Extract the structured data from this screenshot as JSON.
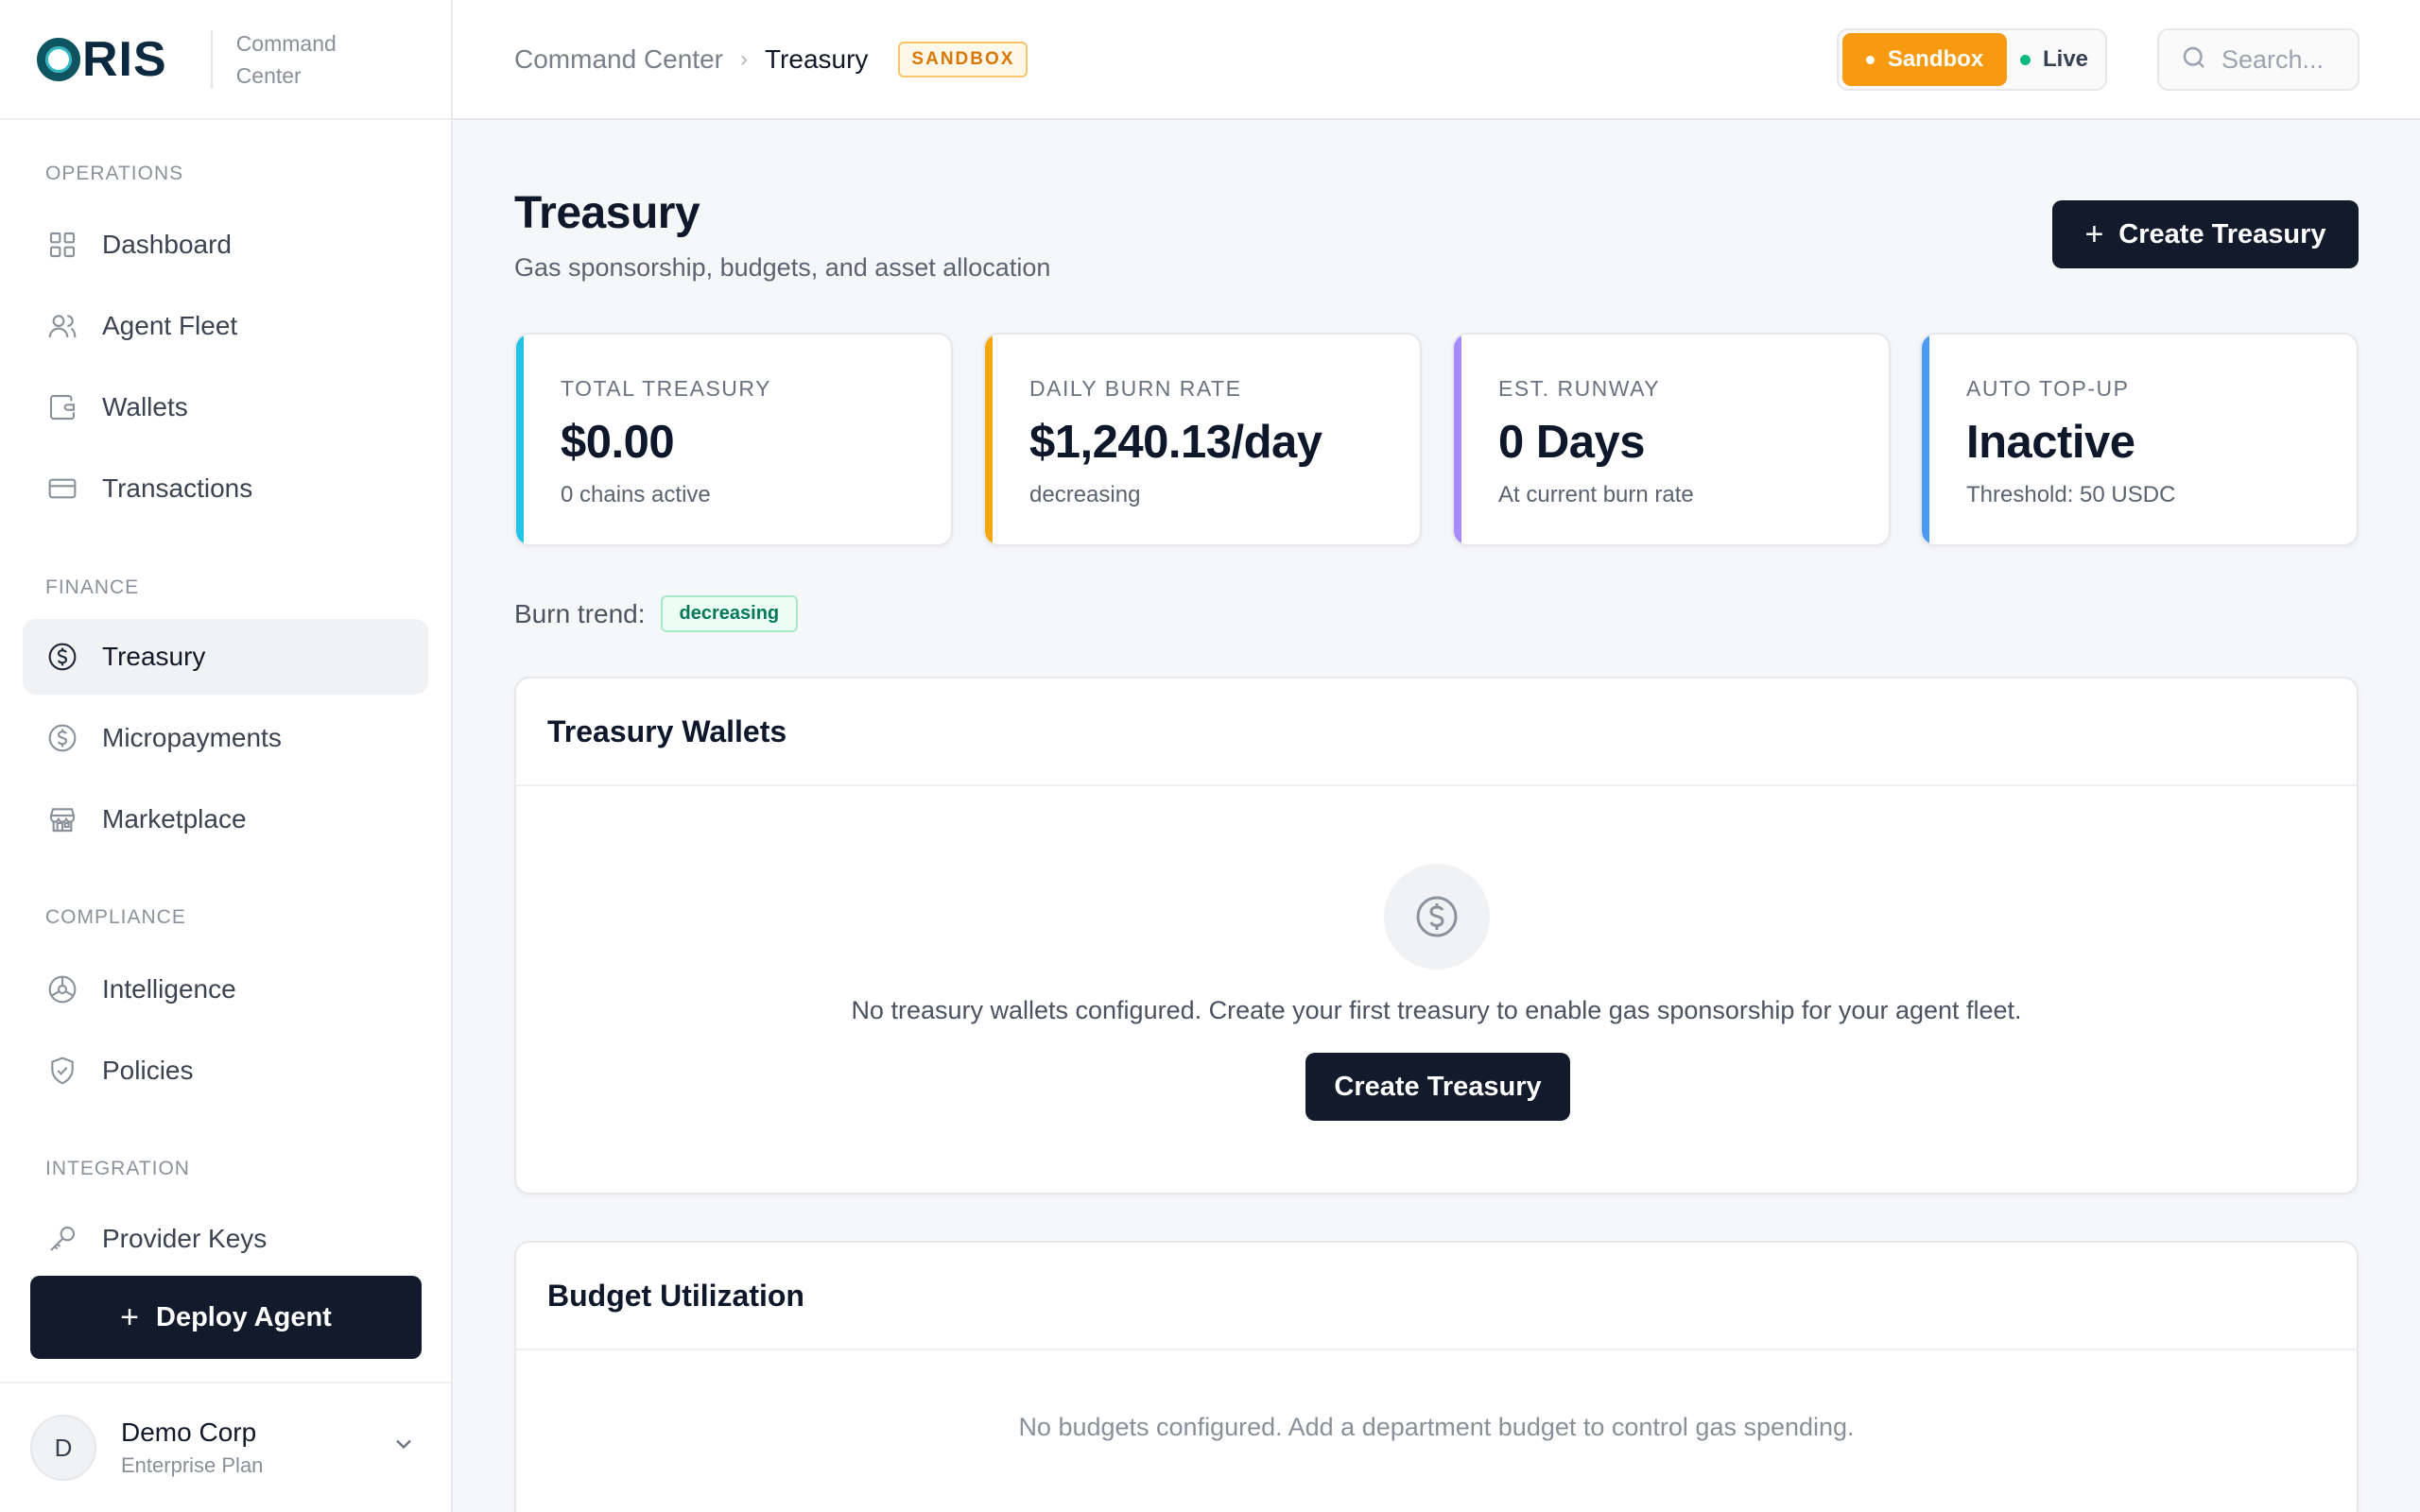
{
  "brand": {
    "logo_text": "RIS",
    "subtitle_line1": "Command",
    "subtitle_line2": "Center"
  },
  "sidebar": {
    "sections": [
      {
        "label": "OPERATIONS"
      },
      {
        "label": "FINANCE"
      },
      {
        "label": "COMPLIANCE"
      },
      {
        "label": "INTEGRATION"
      }
    ],
    "items": [
      {
        "label": "Dashboard",
        "icon": "grid-icon"
      },
      {
        "label": "Agent Fleet",
        "icon": "users-icon"
      },
      {
        "label": "Wallets",
        "icon": "wallet-icon"
      },
      {
        "label": "Transactions",
        "icon": "card-icon"
      },
      {
        "label": "Treasury",
        "icon": "dollar-circle-icon",
        "active": true
      },
      {
        "label": "Micropayments",
        "icon": "dollar-circle-icon"
      },
      {
        "label": "Marketplace",
        "icon": "store-icon"
      },
      {
        "label": "Intelligence",
        "icon": "chart-pie-icon"
      },
      {
        "label": "Policies",
        "icon": "shield-check-icon"
      },
      {
        "label": "Provider Keys",
        "icon": "key-icon"
      }
    ],
    "deploy_label": "Deploy Agent",
    "org": {
      "initial": "D",
      "name": "Demo Corp",
      "plan": "Enterprise Plan"
    }
  },
  "topbar": {
    "breadcrumb_parent": "Command Center",
    "breadcrumb_current": "Treasury",
    "env_tag": "SANDBOX",
    "env_sandbox_label": "Sandbox",
    "env_live_label": "Live",
    "search_placeholder": "Search..."
  },
  "page": {
    "title": "Treasury",
    "subtitle": "Gas sponsorship, budgets, and asset allocation",
    "create_label": "Create Treasury"
  },
  "stats": [
    {
      "label": "TOTAL TREASURY",
      "value": "$0.00",
      "sub": "0 chains active",
      "accent": "#22c3e6"
    },
    {
      "label": "DAILY BURN RATE",
      "value": "$1,240.13/day",
      "sub": "decreasing",
      "accent": "#f5a70f"
    },
    {
      "label": "EST. RUNWAY",
      "value": "0 Days",
      "sub": "At current burn rate",
      "accent": "#a78bfa"
    },
    {
      "label": "AUTO TOP-UP",
      "value": "Inactive",
      "sub": "Threshold: 50 USDC",
      "accent": "#4b9bf5"
    }
  ],
  "burn": {
    "label": "Burn trend:",
    "badge": "decreasing"
  },
  "wallets_panel": {
    "title": "Treasury Wallets",
    "empty_text": "No treasury wallets configured. Create your first treasury to enable gas sponsorship for your agent fleet.",
    "button_label": "Create Treasury"
  },
  "budget_panel": {
    "title": "Budget Utilization",
    "empty_text": "No budgets configured. Add a department budget to control gas spending."
  },
  "colors": {
    "primary_button": "#121a2b",
    "sandbox_orange": "#f79a0f",
    "live_green": "#10b981"
  }
}
